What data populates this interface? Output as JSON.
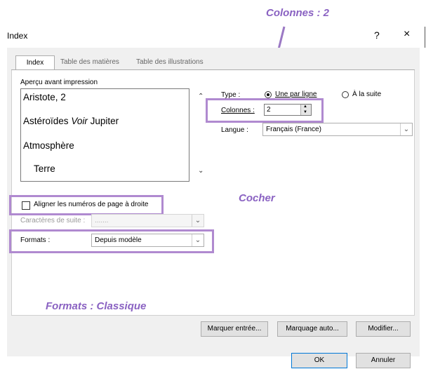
{
  "callouts": {
    "colonnes": "Colonnes : 2",
    "cocher": "Cocher",
    "formats": "Formats : Classique"
  },
  "window": {
    "title": "Index",
    "help": "?",
    "close": "×"
  },
  "tabs": [
    {
      "label": "Index",
      "active": true
    },
    {
      "label": "Table des matières",
      "active": false
    },
    {
      "label": "Table des illustrations",
      "active": false
    }
  ],
  "preview": {
    "label": "Aperçu avant impression",
    "lines": [
      "Aristote, 2",
      "Astéroïdes",
      "Voir",
      "Jupiter",
      "Atmosphère",
      "Terre"
    ]
  },
  "type": {
    "label": "Type :",
    "options": [
      "Une par ligne",
      "À la suite"
    ],
    "selected": "Une par ligne"
  },
  "colonnes": {
    "label": "Colonnes :",
    "value": "2"
  },
  "langue": {
    "label": "Langue :",
    "value": "Français (France)"
  },
  "align": {
    "label": "Aligner les numéros de page à droite",
    "checked": false
  },
  "caracteres": {
    "label": "Caractères de suite :",
    "value": "......."
  },
  "formats": {
    "label": "Formats :",
    "value": "Depuis modèle"
  },
  "buttons": {
    "marquer": "Marquer entrée...",
    "marquage_auto": "Marquage auto...",
    "modifier": "Modifier...",
    "ok": "OK",
    "annuler": "Annuler"
  },
  "colors": {
    "highlight": "#b08ad0",
    "callout_text": "#8a62c2"
  }
}
